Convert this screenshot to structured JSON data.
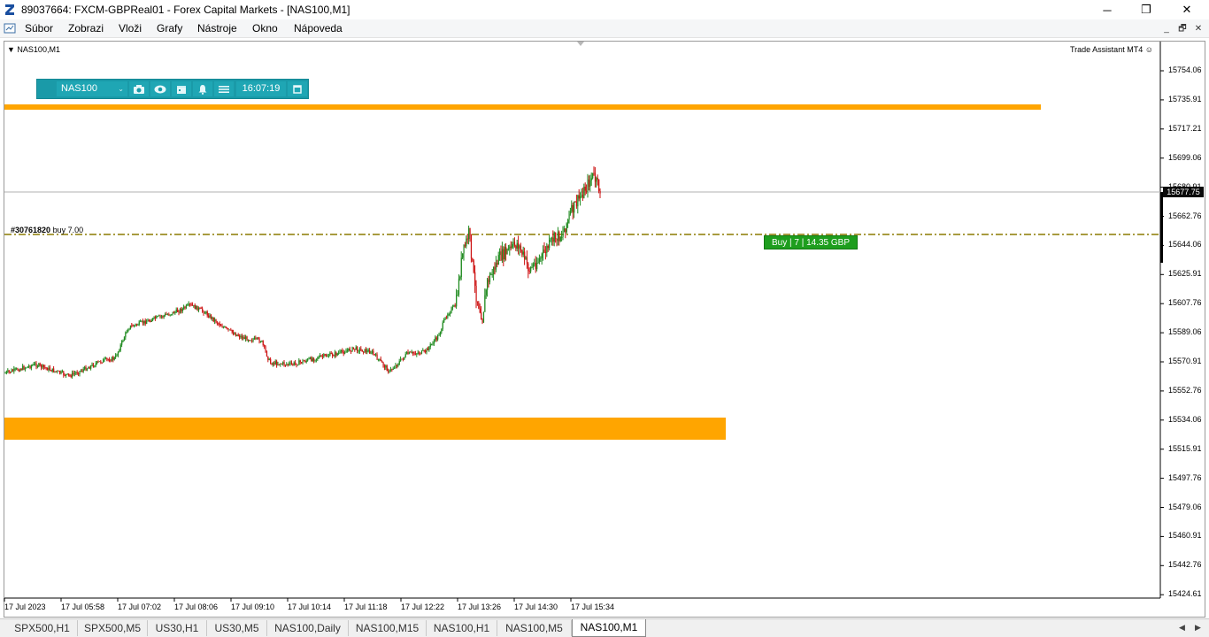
{
  "window": {
    "title": "89037664: FXCM-GBPReal01 - Forex Capital Markets - [NAS100,M1]",
    "minimize": "─",
    "maximize": "❐",
    "close": "✕"
  },
  "menu": {
    "items": [
      "Súbor",
      "Zobrazi",
      "Vloži",
      "Grafy",
      "Nástroje",
      "Okno",
      "Nápoveda"
    ],
    "mdi_minimize": "_",
    "mdi_restore": "🗗",
    "mdi_close": "✕"
  },
  "chart": {
    "symbol_label": "NAS100,M1",
    "indicator_label": "Trade Assistant MT4",
    "current_price": "15677.75",
    "order_id": "#30761820",
    "order_text": "buy 7.00",
    "buy_box": "Buy | 7 | 14.35 GBP",
    "colors": {
      "zone": "#ffa500",
      "order_line": "#8b7a00",
      "bull": "#1f8a1f",
      "bear": "#cc1010",
      "bid_line": "#b0b0b0"
    }
  },
  "toolbar": {
    "symbol": "NAS100",
    "time": "16:07:19",
    "icons": [
      "camera-icon",
      "eye-icon",
      "calendar-icon",
      "bell-icon",
      "menu-icon",
      "window-icon"
    ]
  },
  "price_axis": {
    "ticks": [
      "15754.06",
      "15735.91",
      "15717.21",
      "15699.06",
      "15680.91",
      "15662.76",
      "15644.06",
      "15625.91",
      "15607.76",
      "15589.06",
      "15570.91",
      "15552.76",
      "15534.06",
      "15515.91",
      "15497.76",
      "15479.06",
      "15460.91",
      "15442.76",
      "15424.61"
    ]
  },
  "time_axis": {
    "ticks": [
      "17 Jul 2023",
      "17 Jul 05:58",
      "17 Jul 07:02",
      "17 Jul 08:06",
      "17 Jul 09:10",
      "17 Jul 10:14",
      "17 Jul 11:18",
      "17 Jul 12:22",
      "17 Jul 13:26",
      "17 Jul 14:30",
      "17 Jul 15:34"
    ]
  },
  "tabs": [
    "SPX500,H1",
    "SPX500,M5",
    "US30,H1",
    "US30,M5",
    "NAS100,Daily",
    "NAS100,M15",
    "NAS100,H1",
    "NAS100,M5",
    "NAS100,M1"
  ],
  "active_tab": "NAS100,M1"
}
